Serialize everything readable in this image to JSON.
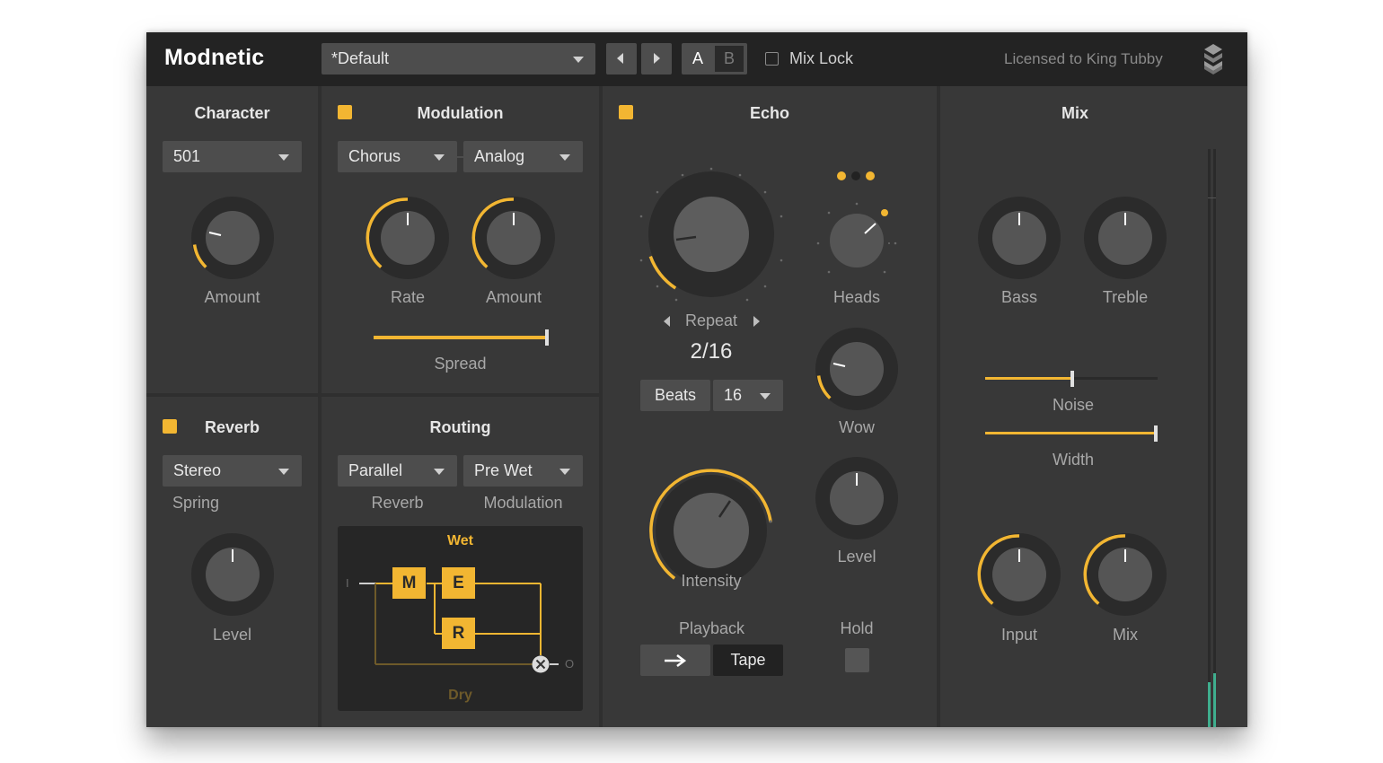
{
  "header": {
    "brand": "Modnetic",
    "preset": "*Default",
    "ab_a": "A",
    "ab_b": "B",
    "mix_lock_label": "Mix Lock",
    "license": "Licensed to King Tubby"
  },
  "character": {
    "title": "Character",
    "mode": "501",
    "amount_label": "Amount"
  },
  "modulation": {
    "title": "Modulation",
    "type": "Chorus",
    "style": "Analog",
    "rate_label": "Rate",
    "amount_label": "Amount",
    "spread_label": "Spread"
  },
  "echo": {
    "title": "Echo",
    "repeat_label": "Repeat",
    "repeat_value": "2/16",
    "beats_label": "Beats",
    "beats_value": "16",
    "heads_label": "Heads",
    "wow_label": "Wow",
    "intensity_label": "Intensity",
    "level_label": "Level",
    "playback_label": "Playback",
    "playback_mode": "Tape",
    "hold_label": "Hold"
  },
  "mix": {
    "title": "Mix",
    "bass_label": "Bass",
    "treble_label": "Treble",
    "noise_label": "Noise",
    "width_label": "Width",
    "input_label": "Input",
    "mix_label": "Mix"
  },
  "reverb": {
    "title": "Reverb",
    "mode": "Stereo",
    "type_label": "Spring",
    "level_label": "Level"
  },
  "routing": {
    "title": "Routing",
    "reverb_route": "Parallel",
    "reverb_caption": "Reverb",
    "modulation_route": "Pre Wet",
    "modulation_caption": "Modulation",
    "wet_label": "Wet",
    "dry_label": "Dry",
    "block_m": "M",
    "block_e": "E",
    "block_r": "R",
    "in_label": "I",
    "out_label": "O"
  },
  "colors": {
    "accent": "#f2b632",
    "panel": "#383838",
    "background": "#2f2f2f",
    "header": "#232323",
    "meter": "#3fae8e"
  }
}
